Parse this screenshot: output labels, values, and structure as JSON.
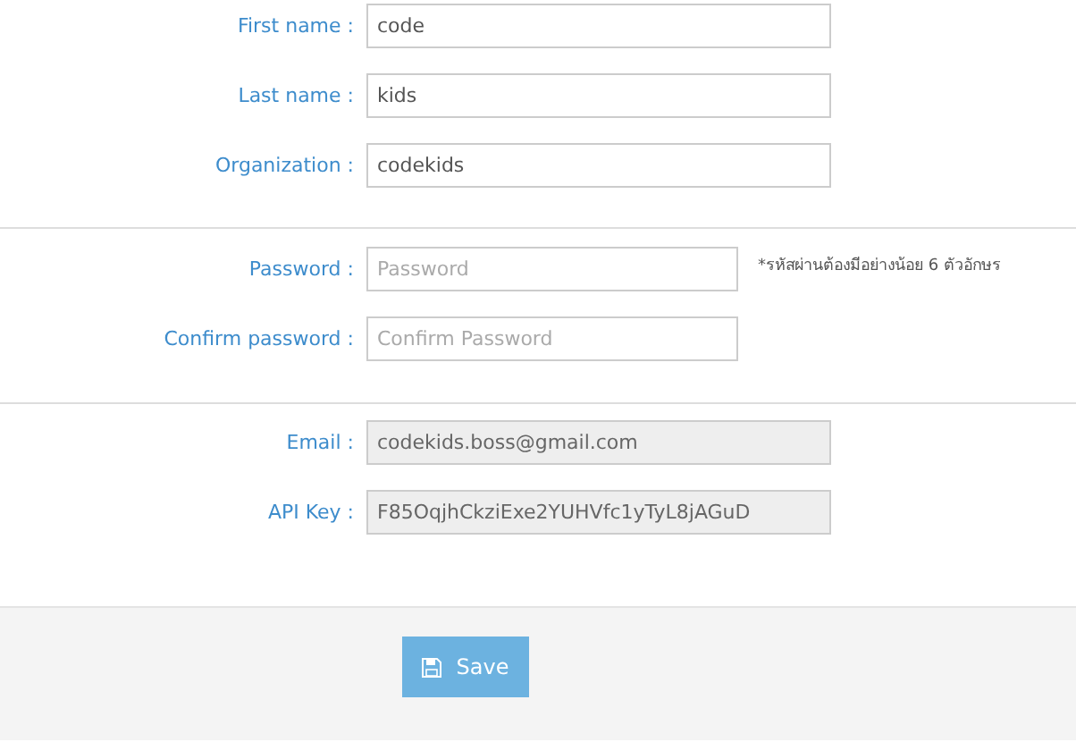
{
  "sections": [
    {
      "fields": [
        {
          "label": "First name :",
          "value": "code",
          "disabled": false
        },
        {
          "label": "Last name :",
          "value": "kids",
          "disabled": false
        },
        {
          "label": "Organization :",
          "value": "codekids",
          "disabled": false
        }
      ]
    },
    {
      "fields": [
        {
          "label": "Password :",
          "placeholder": "Password",
          "disabled": false,
          "note": "*รหัสผ่านต้องมีอย่างน้อย 6 ตัวอักษร"
        },
        {
          "label": "Confirm password :",
          "placeholder": "Confirm Password",
          "disabled": false
        }
      ]
    },
    {
      "fields": [
        {
          "label": "Email :",
          "value": "codekids.boss@gmail.com",
          "disabled": true
        },
        {
          "label": "API Key :",
          "value": "F85OqjhCkziExe2YUHVfc1yTyL8jAGuD",
          "disabled": true
        }
      ]
    }
  ],
  "save_button": {
    "label": "Save"
  }
}
